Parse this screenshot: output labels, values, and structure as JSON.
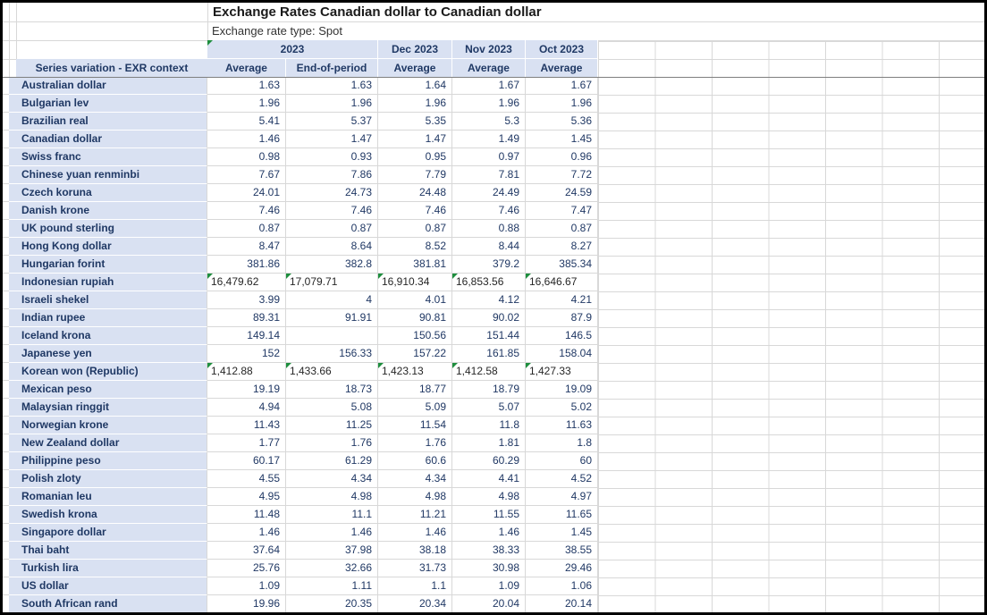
{
  "report": {
    "title": "Exchange Rates Canadian dollar to Canadian dollar",
    "subtitle": "Exchange rate type: Spot",
    "corner_header": "Series variation - EXR context",
    "column_groups": [
      {
        "label": "2023",
        "flagged": true,
        "sub": [
          "Average",
          "End-of-period"
        ]
      },
      {
        "label": "Dec 2023",
        "flagged": false,
        "sub": [
          "Average"
        ]
      },
      {
        "label": "Nov 2023",
        "flagged": false,
        "sub": [
          "Average"
        ]
      },
      {
        "label": "Oct 2023",
        "flagged": false,
        "sub": [
          "Average"
        ]
      }
    ],
    "rows": [
      {
        "label": "Australian dollar",
        "text_format": false,
        "values": [
          "1.63",
          "1.63",
          "1.64",
          "1.67",
          "1.67"
        ]
      },
      {
        "label": "Bulgarian lev",
        "text_format": false,
        "values": [
          "1.96",
          "1.96",
          "1.96",
          "1.96",
          "1.96"
        ]
      },
      {
        "label": "Brazilian real",
        "text_format": false,
        "values": [
          "5.41",
          "5.37",
          "5.35",
          "5.3",
          "5.36"
        ]
      },
      {
        "label": "Canadian dollar",
        "text_format": false,
        "values": [
          "1.46",
          "1.47",
          "1.47",
          "1.49",
          "1.45"
        ]
      },
      {
        "label": "Swiss franc",
        "text_format": false,
        "values": [
          "0.98",
          "0.93",
          "0.95",
          "0.97",
          "0.96"
        ]
      },
      {
        "label": "Chinese yuan renminbi",
        "text_format": false,
        "values": [
          "7.67",
          "7.86",
          "7.79",
          "7.81",
          "7.72"
        ]
      },
      {
        "label": "Czech koruna",
        "text_format": false,
        "values": [
          "24.01",
          "24.73",
          "24.48",
          "24.49",
          "24.59"
        ]
      },
      {
        "label": "Danish krone",
        "text_format": false,
        "values": [
          "7.46",
          "7.46",
          "7.46",
          "7.46",
          "7.47"
        ]
      },
      {
        "label": "UK pound sterling",
        "text_format": false,
        "values": [
          "0.87",
          "0.87",
          "0.87",
          "0.88",
          "0.87"
        ]
      },
      {
        "label": "Hong Kong dollar",
        "text_format": false,
        "values": [
          "8.47",
          "8.64",
          "8.52",
          "8.44",
          "8.27"
        ]
      },
      {
        "label": "Hungarian forint",
        "text_format": false,
        "values": [
          "381.86",
          "382.8",
          "381.81",
          "379.2",
          "385.34"
        ]
      },
      {
        "label": "Indonesian rupiah",
        "text_format": true,
        "values": [
          "16,479.62",
          "17,079.71",
          "16,910.34",
          "16,853.56",
          "16,646.67"
        ]
      },
      {
        "label": "Israeli shekel",
        "text_format": false,
        "values": [
          "3.99",
          "4",
          "4.01",
          "4.12",
          "4.21"
        ]
      },
      {
        "label": "Indian rupee",
        "text_format": false,
        "values": [
          "89.31",
          "91.91",
          "90.81",
          "90.02",
          "87.9"
        ]
      },
      {
        "label": "Iceland krona",
        "text_format": false,
        "values": [
          "149.14",
          "",
          "150.56",
          "151.44",
          "146.5"
        ]
      },
      {
        "label": "Japanese yen",
        "text_format": false,
        "values": [
          "152",
          "156.33",
          "157.22",
          "161.85",
          "158.04"
        ]
      },
      {
        "label": "Korean won (Republic)",
        "text_format": true,
        "values": [
          "1,412.88",
          "1,433.66",
          "1,423.13",
          "1,412.58",
          "1,427.33"
        ]
      },
      {
        "label": "Mexican peso",
        "text_format": false,
        "values": [
          "19.19",
          "18.73",
          "18.77",
          "18.79",
          "19.09"
        ]
      },
      {
        "label": "Malaysian ringgit",
        "text_format": false,
        "values": [
          "4.94",
          "5.08",
          "5.09",
          "5.07",
          "5.02"
        ]
      },
      {
        "label": "Norwegian krone",
        "text_format": false,
        "values": [
          "11.43",
          "11.25",
          "11.54",
          "11.8",
          "11.63"
        ]
      },
      {
        "label": "New Zealand dollar",
        "text_format": false,
        "values": [
          "1.77",
          "1.76",
          "1.76",
          "1.81",
          "1.8"
        ]
      },
      {
        "label": "Philippine peso",
        "text_format": false,
        "values": [
          "60.17",
          "61.29",
          "60.6",
          "60.29",
          "60"
        ]
      },
      {
        "label": "Polish zloty",
        "text_format": false,
        "values": [
          "4.55",
          "4.34",
          "4.34",
          "4.41",
          "4.52"
        ]
      },
      {
        "label": "Romanian leu",
        "text_format": false,
        "values": [
          "4.95",
          "4.98",
          "4.98",
          "4.98",
          "4.97"
        ]
      },
      {
        "label": "Swedish krona",
        "text_format": false,
        "values": [
          "11.48",
          "11.1",
          "11.21",
          "11.55",
          "11.65"
        ]
      },
      {
        "label": "Singapore dollar",
        "text_format": false,
        "values": [
          "1.46",
          "1.46",
          "1.46",
          "1.46",
          "1.45"
        ]
      },
      {
        "label": "Thai baht",
        "text_format": false,
        "values": [
          "37.64",
          "37.98",
          "38.18",
          "38.33",
          "38.55"
        ]
      },
      {
        "label": "Turkish lira",
        "text_format": false,
        "values": [
          "25.76",
          "32.66",
          "31.73",
          "30.98",
          "29.46"
        ]
      },
      {
        "label": "US dollar",
        "text_format": false,
        "values": [
          "1.09",
          "1.11",
          "1.1",
          "1.09",
          "1.06"
        ]
      },
      {
        "label": "South African rand",
        "text_format": false,
        "values": [
          "19.96",
          "20.35",
          "20.34",
          "20.04",
          "20.14"
        ]
      }
    ]
  },
  "colors": {
    "header_background": "#d9e1f2",
    "label_text": "#1f3864",
    "value_text": "#203864",
    "text_format_value_text": "#262626",
    "grid_line": "#d8d8d8",
    "freeze_line": "#7f7f7f",
    "flag_green": "#1e8e3e",
    "frame_border": "#000000"
  }
}
